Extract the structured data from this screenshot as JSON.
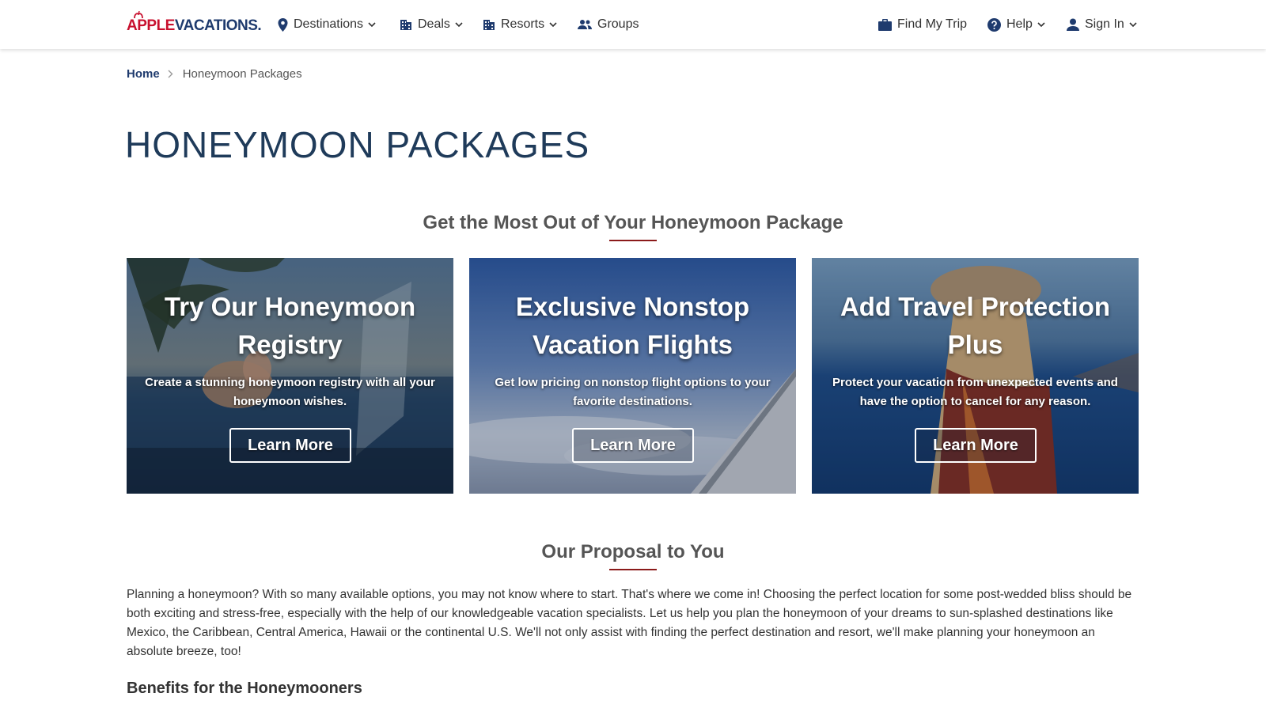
{
  "brand": {
    "logo_part1": "APPLE",
    "logo_part2": "VACATIONS."
  },
  "nav": {
    "destinations": "Destinations",
    "deals": "Deals",
    "resorts": "Resorts",
    "groups": "Groups",
    "find_my_trip": "Find My Trip",
    "help": "Help",
    "sign_in": "Sign In"
  },
  "breadcrumb": {
    "home": "Home",
    "current": "Honeymoon Packages"
  },
  "page_title": "HONEYMOON PACKAGES",
  "section1": {
    "heading": "Get the Most Out of Your Honeymoon Package"
  },
  "cards": [
    {
      "title": "Try Our Honeymoon Registry",
      "text": "Create a stunning honeymoon registry with all your honeymoon wishes.",
      "button": "Learn More"
    },
    {
      "title": "Exclusive Nonstop Vacation Flights",
      "text": "Get low pricing on nonstop flight options to your favorite destinations.",
      "button": "Learn More"
    },
    {
      "title": "Add Travel Protection Plus",
      "text": "Protect your vacation from unexpected events and have the option to cancel for any reason.",
      "button": "Learn More"
    }
  ],
  "section2": {
    "heading": "Our Proposal to You",
    "body": "Planning a honeymoon? With so many available options, you may not know where to start. That's where we come in! Choosing the perfect location for some post-wedded bliss should be both exciting and stress-free, especially with the help of our knowledgeable vacation specialists. Let us help you plan the honeymoon of your dreams to sun-splashed destinations like Mexico, the Caribbean, Central America, Hawaii or the continental U.S. We'll not only assist with finding the perfect destination and resort, we'll make planning your honeymoon an absolute breeze, too!",
    "subheading": "Benefits for the Honeymooners"
  },
  "colors": {
    "brand_red": "#c8102e",
    "brand_blue": "#1f3b6e",
    "accent_underline": "#8b1a1a"
  }
}
